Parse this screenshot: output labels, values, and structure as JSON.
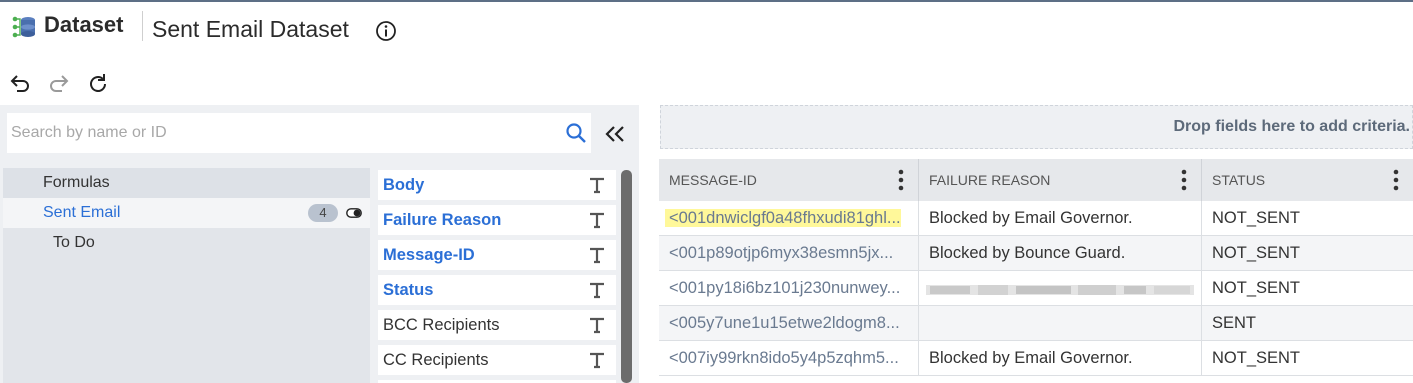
{
  "app": {
    "name": "Dataset",
    "page_title": "Sent Email Dataset"
  },
  "icons": {
    "app": "dataset-icon",
    "info": "info-icon",
    "undo": "undo-icon",
    "redo": "redo-icon",
    "refresh": "refresh-icon",
    "search": "search-icon",
    "collapse": "double-chevron-left-icon",
    "text_type": "text-type-icon",
    "kebab": "kebab-menu-icon",
    "toggle": "toggle-icon"
  },
  "colors": {
    "accent": "#2b6fd6",
    "highlight": "#fff89a",
    "panel": "#eef0f3"
  },
  "search": {
    "placeholder": "Search by name or ID",
    "value": ""
  },
  "tree": {
    "items": [
      {
        "label": "Formulas"
      },
      {
        "label": "Sent Email",
        "count": "4",
        "selected": true
      },
      {
        "label": "To Do"
      }
    ]
  },
  "fields": [
    {
      "label": "Body",
      "emphasis": true
    },
    {
      "label": "Failure Reason",
      "emphasis": true
    },
    {
      "label": "Message-ID",
      "emphasis": true
    },
    {
      "label": "Status",
      "emphasis": true
    },
    {
      "label": "BCC Recipients",
      "emphasis": false
    },
    {
      "label": "CC Recipients",
      "emphasis": false
    }
  ],
  "criteria": {
    "drop_text": "Drop fields here to add criteria."
  },
  "table": {
    "columns": [
      "MESSAGE-ID",
      "FAILURE REASON",
      "STATUS"
    ],
    "rows": [
      {
        "message_id": "<001dnwiclgf0a48fhxudi81ghl...",
        "reason": "Blocked by Email Governor.",
        "status": "NOT_SENT"
      },
      {
        "message_id": "<001p89otjp6myx38esmn5jx...",
        "reason": "Blocked by Bounce Guard.",
        "status": "NOT_SENT"
      },
      {
        "message_id": "<001py18i6bz101j230nunwey...",
        "reason": "",
        "status": "NOT_SENT"
      },
      {
        "message_id": "<005y7une1u15etwe2ldogm8...",
        "reason": "",
        "status": "SENT"
      },
      {
        "message_id": "<007iy99rkn8ido5y4p5zqhm5...",
        "reason": "Blocked by Email Governor.",
        "status": "NOT_SENT"
      }
    ]
  }
}
